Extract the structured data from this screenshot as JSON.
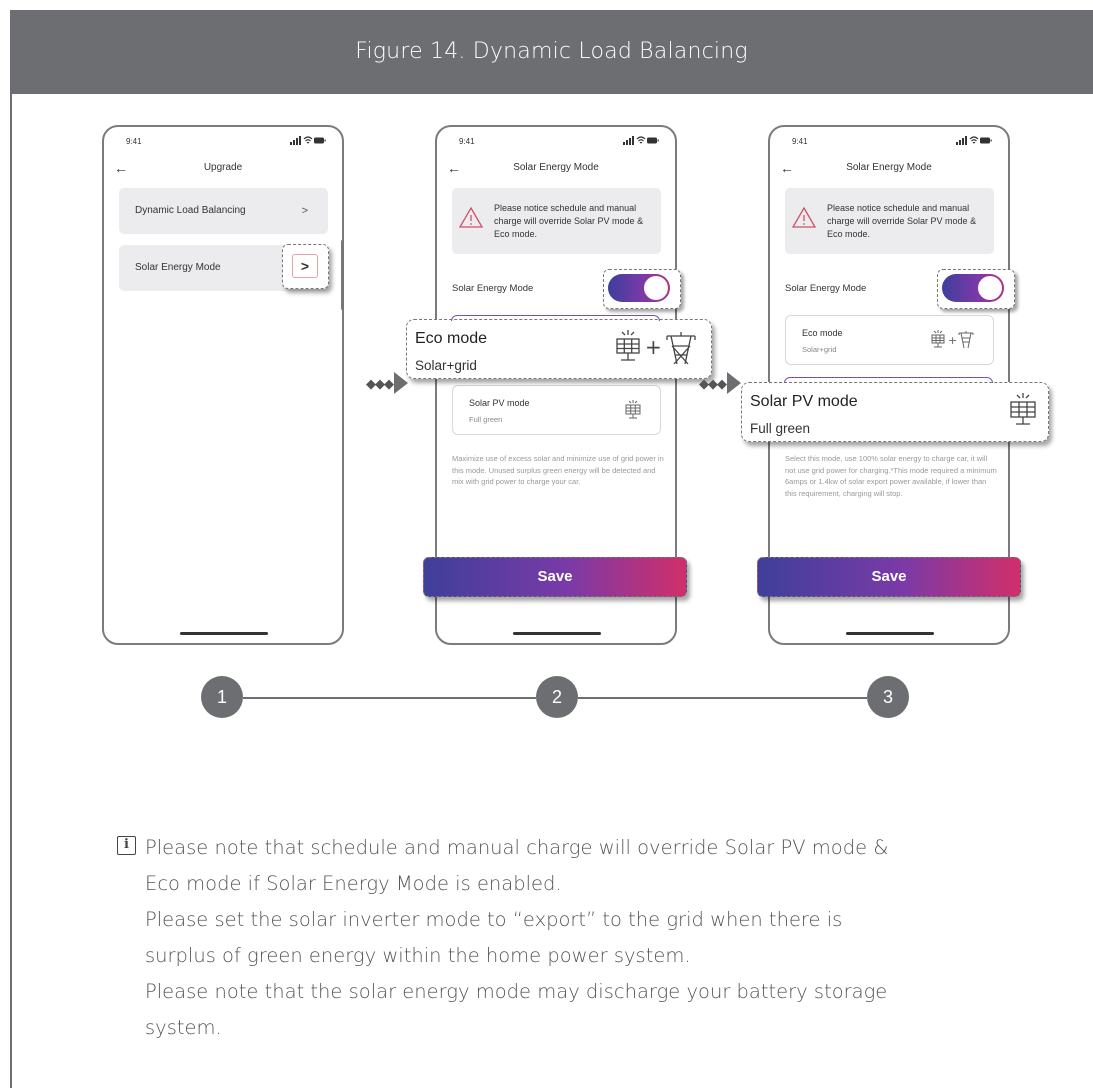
{
  "figure": {
    "title": "Figure 14.  Dynamic Load Balancing"
  },
  "status": {
    "time": "9:41",
    "icons": "signal wifi battery"
  },
  "phone1": {
    "title": "Upgrade",
    "back_icon": "arrow-left-icon",
    "rows": [
      {
        "label": "Dynamic Load Balancing",
        "chevron": ">"
      },
      {
        "label": "Solar Energy Mode",
        "chevron": ">"
      }
    ]
  },
  "phone2": {
    "title": "Solar Energy Mode",
    "notice": "Please notice schedule and manual charge will override Solar PV mode & Eco mode.",
    "toggle_label": "Solar Energy Mode",
    "toggle_on": true,
    "eco_callout": {
      "title": "Eco mode",
      "subtitle": "Solar+grid",
      "icon": "solar-panel-plus-pylon-icon"
    },
    "pv_box": {
      "title": "Solar PV mode",
      "subtitle": "Full green",
      "icon": "solar-panel-icon"
    },
    "description": "Maximize use of excess solar and minimize use of grid power in this mode. Unused surplus green energy will be detected and mix with grid power to charge your car.",
    "save": "Save"
  },
  "phone3": {
    "title": "Solar Energy Mode",
    "notice": "Please notice schedule and manual charge will override Solar PV mode & Eco mode.",
    "toggle_label": "Solar Energy Mode",
    "toggle_on": true,
    "eco_box": {
      "title": "Eco mode",
      "subtitle": "Solar+grid",
      "icon": "solar-panel-plus-pylon-icon"
    },
    "pv_callout": {
      "title": "Solar PV mode",
      "subtitle": "Full green",
      "icon": "solar-panel-icon"
    },
    "description": "Select this mode, use 100% solar energy to charge car, it will not use grid power for charging.*This mode required a minimum 6amps or 1.4kw of solar export power available, if lower than this requirement, charging will stop.",
    "save": "Save"
  },
  "steps": [
    "1",
    "2",
    "3"
  ],
  "note": {
    "icon": "i",
    "lines": [
      "Please note that schedule and manual charge will override Solar PV mode & Eco mode if Solar Energy Mode is enabled.",
      "Please set the solar inverter mode to “export” to the grid when there is surplus of green energy within the home power system.",
      "Please note that the solar energy mode may discharge your battery storage system."
    ]
  }
}
